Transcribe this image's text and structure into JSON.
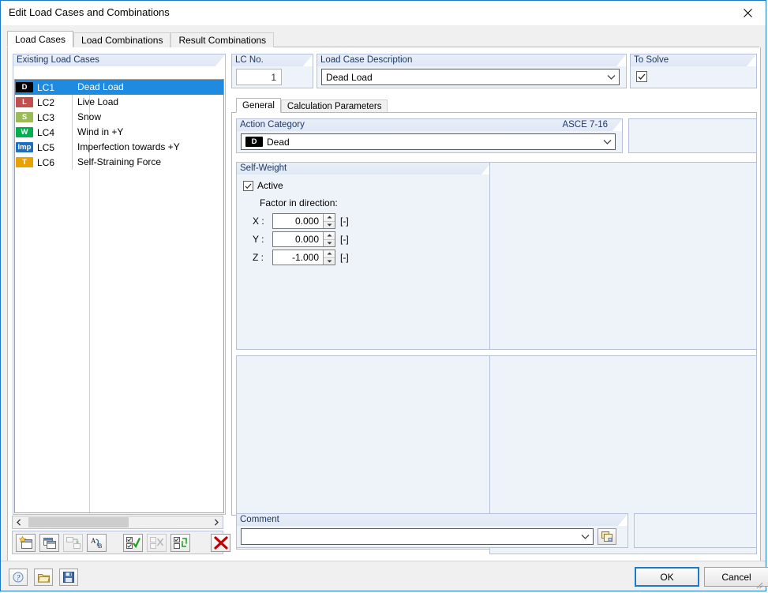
{
  "window": {
    "title": "Edit Load Cases and Combinations",
    "close_icon": "close-icon"
  },
  "tabs": [
    {
      "label": "Load Cases",
      "active": true
    },
    {
      "label": "Load Combinations",
      "active": false
    },
    {
      "label": "Result Combinations",
      "active": false
    }
  ],
  "existing_load_cases": {
    "group_title": "Existing Load Cases",
    "rows": [
      {
        "badge": "D",
        "badge_color": "#000000",
        "no": "LC1",
        "description": "Dead Load",
        "selected": true
      },
      {
        "badge": "L",
        "badge_color": "#c0504d",
        "no": "LC2",
        "description": "Live Load",
        "selected": false
      },
      {
        "badge": "S",
        "badge_color": "#9bbb59",
        "no": "LC3",
        "description": "Snow",
        "selected": false
      },
      {
        "badge": "W",
        "badge_color": "#00b050",
        "no": "LC4",
        "description": "Wind in +Y",
        "selected": false
      },
      {
        "badge": "Imp",
        "badge_color": "#1f6fc0",
        "no": "LC5",
        "description": "Imperfection towards +Y",
        "selected": false
      },
      {
        "badge": "T",
        "badge_color": "#e8a200",
        "no": "LC6",
        "description": "Self-Straining Force",
        "selected": false
      }
    ],
    "scroll_left_icon": "chevron-left-icon",
    "scroll_right_icon": "chevron-right-icon"
  },
  "list_toolbar": [
    {
      "name": "new-load-case-button",
      "icon": "new-window-icon",
      "enabled": true
    },
    {
      "name": "copy-load-case-button",
      "icon": "copy-window-icon",
      "enabled": true
    },
    {
      "name": "convert-load-case-button",
      "icon": "convert-icon",
      "enabled": false
    },
    {
      "name": "rename-load-case-button",
      "icon": "rename-ab-icon",
      "enabled": true
    },
    {
      "name": "select-all-button",
      "icon": "check-all-icon",
      "enabled": true
    },
    {
      "name": "deselect-all-button",
      "icon": "uncheck-all-icon",
      "enabled": false
    },
    {
      "name": "invert-selection-button",
      "icon": "invert-selection-icon",
      "enabled": true
    },
    {
      "name": "delete-load-case-button",
      "icon": "red-x-icon",
      "enabled": true
    }
  ],
  "lc_no": {
    "group_title": "LC No.",
    "value": "1"
  },
  "load_case_description": {
    "group_title": "Load Case Description",
    "value": "Dead Load",
    "dropdown_icon": "chevron-down-icon"
  },
  "to_solve": {
    "group_title": "To Solve",
    "checked": true,
    "check_icon": "checkmark-icon"
  },
  "inner_tabs": [
    {
      "label": "General",
      "active": true
    },
    {
      "label": "Calculation Parameters",
      "active": false
    }
  ],
  "action_category": {
    "group_title": "Action Category",
    "standard": "ASCE 7-16",
    "badge": "D",
    "badge_color": "#000000",
    "value": "Dead",
    "dropdown_icon": "chevron-down-icon"
  },
  "self_weight": {
    "group_title": "Self-Weight",
    "active_label": "Active",
    "active_checked": true,
    "factor_label": "Factor in direction:",
    "factors": [
      {
        "axis": "X :",
        "value": "0.000",
        "unit": "[-]"
      },
      {
        "axis": "Y :",
        "value": "0.000",
        "unit": "[-]"
      },
      {
        "axis": "Z :",
        "value": "-1.000",
        "unit": "[-]"
      }
    ],
    "spin_up_icon": "spinner-up-icon",
    "spin_down_icon": "spinner-down-icon"
  },
  "comment": {
    "group_title": "Comment",
    "value": "",
    "dropdown_icon": "chevron-down-icon",
    "picker_icon": "comment-library-icon"
  },
  "bottom_bar": {
    "help_icon": "help-icon",
    "open_icon": "open-folder-icon",
    "save_icon": "save-disk-icon",
    "ok_label": "OK",
    "cancel_label": "Cancel",
    "resize_grip_icon": "resize-grip-icon"
  }
}
